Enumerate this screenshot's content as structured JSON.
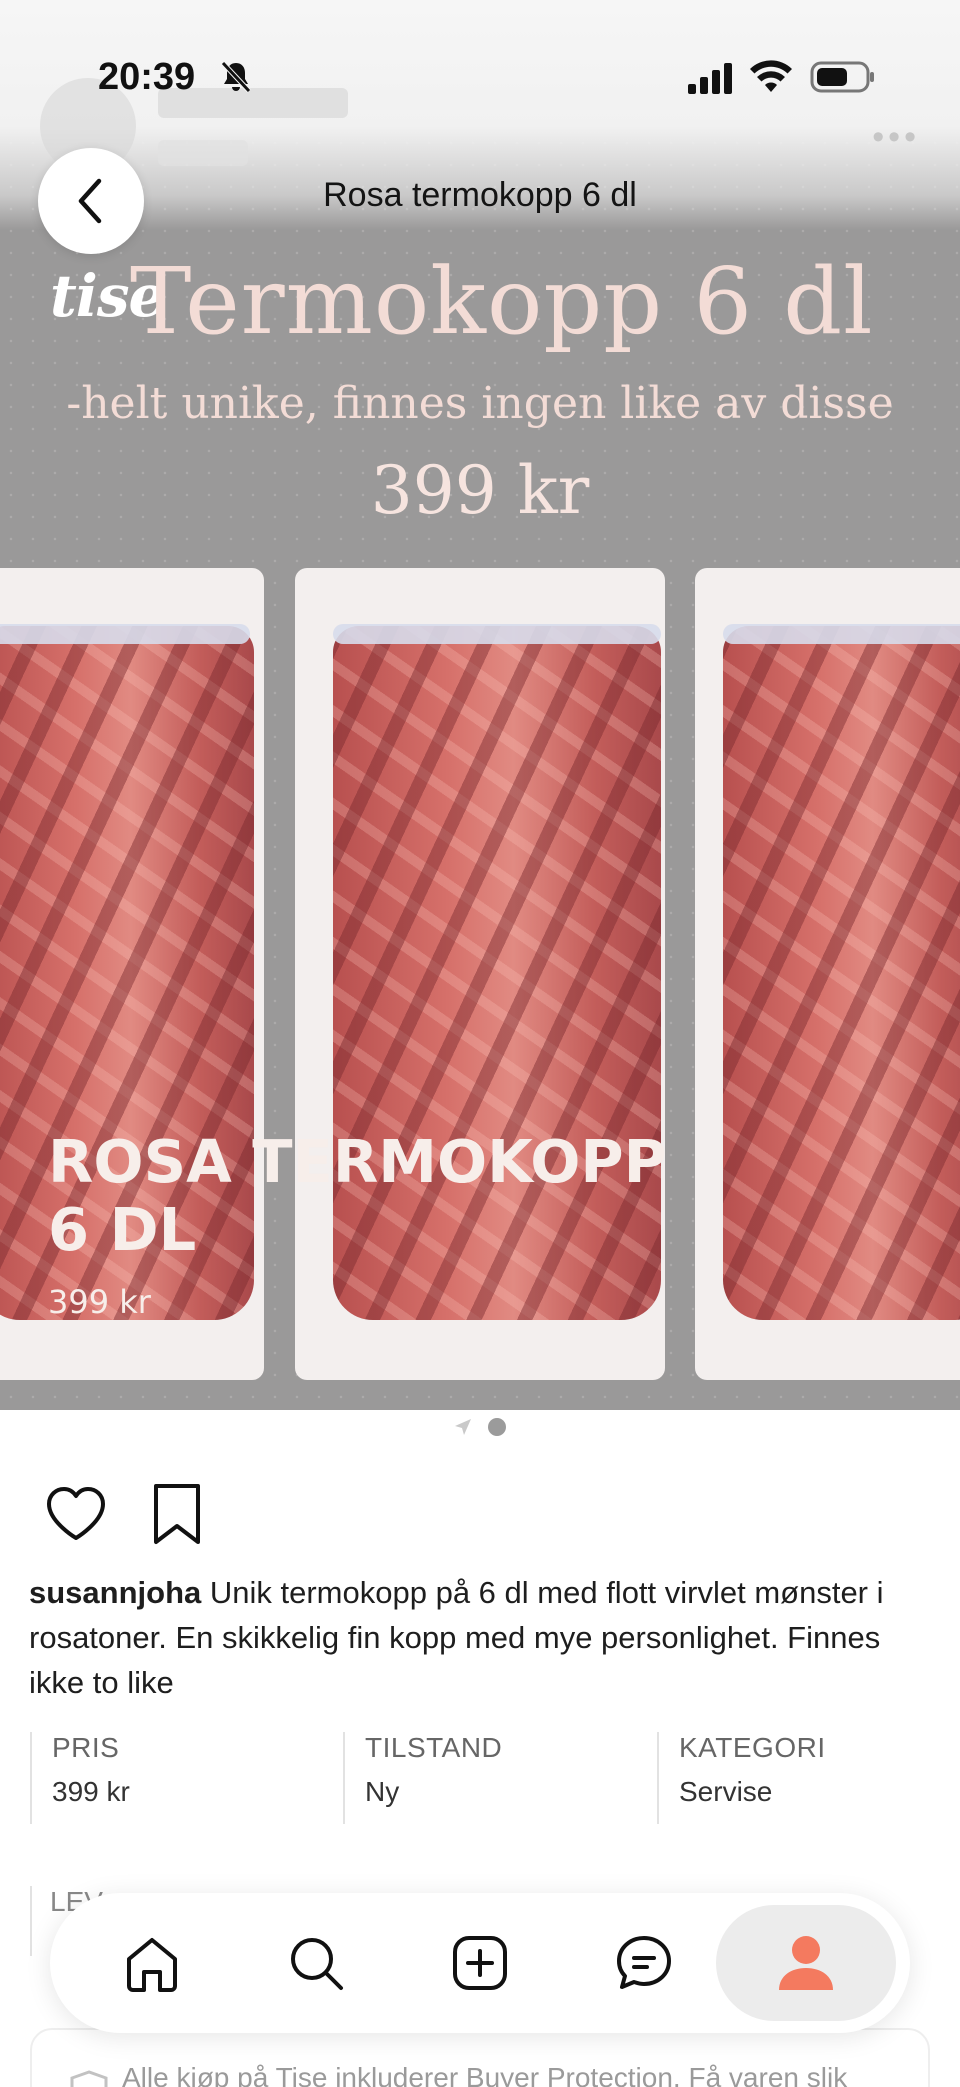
{
  "status_bar": {
    "time": "20:39",
    "icons": [
      "bell-off-icon",
      "signal-icon",
      "wifi-icon",
      "battery-icon"
    ]
  },
  "header": {
    "title": "Rosa termokopp 6 dl",
    "back_icon": "chevron-left-icon"
  },
  "image": {
    "logo": "tise",
    "banner_title": "Termokopp 6 dl",
    "banner_subtitle": "-helt unike, finnes ingen like av disse",
    "banner_price": "399 kr",
    "overlay_title": "ROSA TERMOKOPP 6 DL",
    "overlay_price": "399 kr"
  },
  "pagination": {
    "active_page": 2,
    "total_pages": 2
  },
  "actions": {
    "like_icon": "heart-icon",
    "save_icon": "bookmark-icon"
  },
  "description": {
    "username": "susannjoha",
    "text": " Unik termokopp på 6 dl med flott virvlet mønster i rosatoner. En skikkelig fin kopp med mye personlighet. Finnes ikke to like"
  },
  "details": [
    {
      "label": "PRIS",
      "value": "399 kr"
    },
    {
      "label": "TILSTAND",
      "value": "Ny"
    },
    {
      "label": "KATEGORI",
      "value": "Servise"
    }
  ],
  "partial": {
    "delivery_label": "LEV",
    "protection_text": "Alle kjøp på Tise inkluderer Buyer Protection. Få varen slik"
  },
  "tabbar": {
    "items": [
      "home-icon",
      "search-icon",
      "add-icon",
      "chat-icon",
      "profile-icon"
    ],
    "active": "profile",
    "accent": "#f47a5f"
  }
}
